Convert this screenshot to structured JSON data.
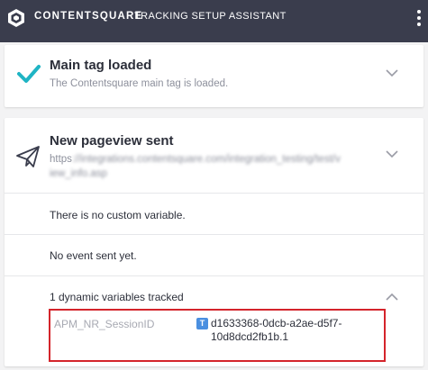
{
  "header": {
    "brand": "CONTENTSQUARE",
    "title": "TRACKING SETUP ASSISTANT",
    "logo_icon": "contentsquare-logo-icon",
    "menu_icon": "vertical-dots-icon"
  },
  "main_tag": {
    "title": "Main tag loaded",
    "subtitle": "The Contentsquare main tag is loaded.",
    "status_icon": "check-icon"
  },
  "pageview": {
    "title": "New pageview sent",
    "url_prefix": "https",
    "url_blurred": "://integrations.contentsquare.com/integration_testing/test/view_info.asp",
    "status_icon": "paper-plane-icon",
    "custom_variables_text": "There is no custom variable.",
    "events_text": "No event sent yet.",
    "dynamic_variables_header": "1 dynamic variables tracked",
    "dynamic_variables": [
      {
        "name": "APM_NR_SessionID",
        "type_badge": "T",
        "value": "d1633368-0dcb-a2ae-d5f7-10d8dcd2fb1b.1"
      }
    ]
  },
  "colors": {
    "header_bg": "#3a3d4d",
    "check_teal": "#1fb4c4",
    "highlight_red": "#d4242b",
    "badge_blue": "#4a8fe0"
  }
}
